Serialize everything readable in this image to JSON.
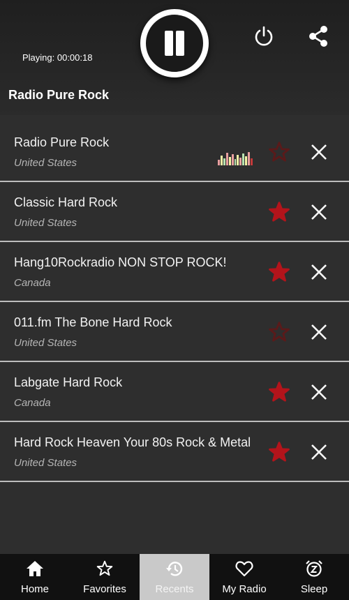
{
  "player": {
    "playing_label": "Playing: 00:00:18",
    "station_title": "Radio Pure Rock"
  },
  "stations": [
    {
      "name": "Radio Pure Rock",
      "country": "United States",
      "favorite": false,
      "now_playing": true
    },
    {
      "name": "Classic Hard Rock",
      "country": "United States",
      "favorite": true,
      "now_playing": false
    },
    {
      "name": "Hang10Rockradio NON STOP ROCK!",
      "country": "Canada",
      "favorite": true,
      "now_playing": false
    },
    {
      "name": "011.fm The Bone Hard Rock",
      "country": "United States",
      "favorite": false,
      "now_playing": false
    },
    {
      "name": "Labgate Hard Rock",
      "country": "Canada",
      "favorite": true,
      "now_playing": false
    },
    {
      "name": "Hard Rock Heaven Your 80s Rock & Metal",
      "country": "United States",
      "favorite": true,
      "now_playing": false
    }
  ],
  "nav": {
    "home": "Home",
    "favorites": "Favorites",
    "recents": "Recents",
    "my_radio": "My Radio",
    "sleep": "Sleep",
    "active": "recents"
  },
  "icons": {
    "pause": "pause-icon",
    "power": "power-icon",
    "share": "share-icon",
    "star": "star-icon",
    "close": "close-icon",
    "home": "home-icon",
    "favorites": "star-outline-icon",
    "recents": "history-icon",
    "my_radio": "heart-icon",
    "sleep": "alarm-z-icon"
  },
  "colors": {
    "star_filled": "#b3141b",
    "star_outline": "#5a1a1a",
    "nav_active_bg": "#c9c9c9",
    "nav_bg": "#111111"
  }
}
